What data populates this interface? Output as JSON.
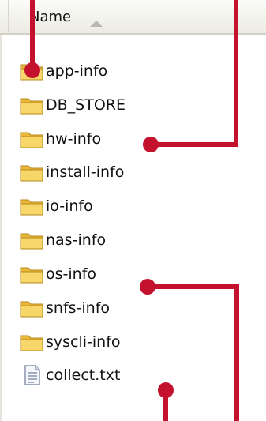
{
  "header": {
    "name_label": "Name"
  },
  "items": [
    {
      "label": "app-info",
      "icon": "folder-icon"
    },
    {
      "label": "DB_STORE",
      "icon": "folder-icon"
    },
    {
      "label": "hw-info",
      "icon": "folder-icon"
    },
    {
      "label": "install-info",
      "icon": "folder-icon"
    },
    {
      "label": "io-info",
      "icon": "folder-icon"
    },
    {
      "label": "nas-info",
      "icon": "folder-icon"
    },
    {
      "label": "os-info",
      "icon": "folder-icon"
    },
    {
      "label": "snfs-info",
      "icon": "folder-icon"
    },
    {
      "label": "syscli-info",
      "icon": "folder-icon"
    },
    {
      "label": "collect.txt",
      "icon": "text-file-icon"
    }
  ],
  "colors": {
    "callout": "#c4122e",
    "folder": "#f2c94c"
  }
}
